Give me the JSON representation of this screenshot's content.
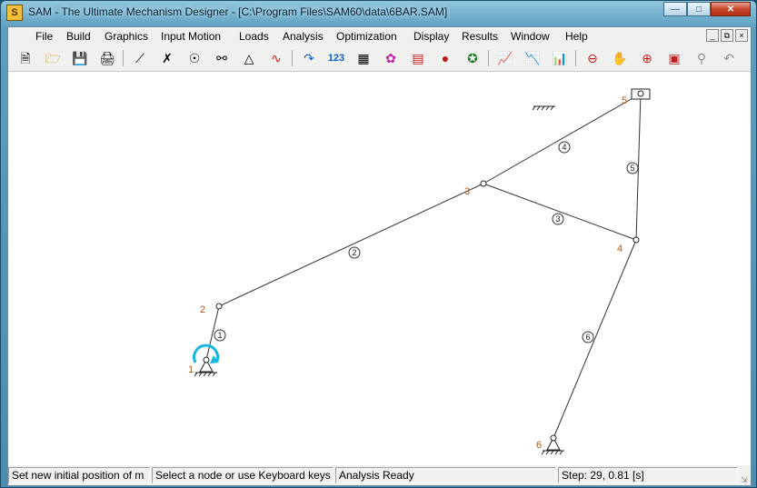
{
  "window": {
    "title": "SAM - The Ultimate Mechanism Designer - [C:\\Program Files\\SAM60\\data\\6BAR.SAM]"
  },
  "menu": [
    "File",
    "Build",
    "Graphics",
    "Input Motion",
    "Loads",
    "Analysis",
    "Optimization",
    "Display",
    "Results",
    "Window",
    "Help"
  ],
  "toolbar_icons": [
    "new-file-icon",
    "open-folder-icon",
    "save-icon",
    "print-icon",
    "line-element-icon",
    "slider-element-icon",
    "hinge-icon",
    "belt-pulley-icon",
    "fix-support-icon",
    "spring-icon",
    "input-motion-icon",
    "numeric-123-icon",
    "calculator-icon",
    "analysis-icon",
    "table-icon",
    "pin-icon",
    "windmill-icon",
    "xy-chart-icon",
    "xy-chart-2-icon",
    "xy-chart-3-icon",
    "zoom-out-icon",
    "pan-hand-icon",
    "zoom-in-icon",
    "zoom-window-icon",
    "zoom-fit-icon",
    "undo-icon"
  ],
  "mechanism": {
    "nodes": [
      {
        "label": "1"
      },
      {
        "label": "2"
      },
      {
        "label": "3"
      },
      {
        "label": "4"
      },
      {
        "label": "5"
      },
      {
        "label": "6"
      }
    ],
    "links": [
      {
        "label": "1"
      },
      {
        "label": "2"
      },
      {
        "label": "3"
      },
      {
        "label": "4"
      },
      {
        "label": "5"
      },
      {
        "label": "6"
      }
    ]
  },
  "status": {
    "hint": "Set new initial position of m",
    "select": "Select a node or use Keyboard keys",
    "analysis": "Analysis Ready",
    "step": "Step: 29,     0.81 [s]"
  },
  "colors": {
    "title_gradient": "#5c9ec0",
    "close_button": "#c6452a",
    "node_label": "#b05a10",
    "input_arrow": "#19b6e0"
  }
}
